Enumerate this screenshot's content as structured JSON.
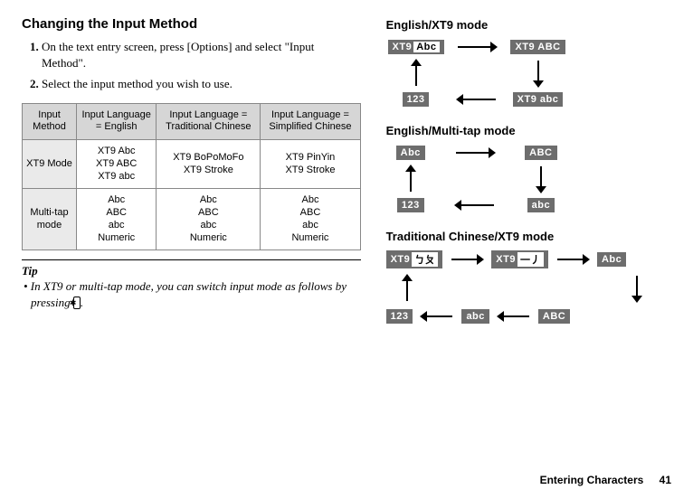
{
  "left": {
    "heading": "Changing the Input Method",
    "steps": [
      "On the text entry screen, press [Options] and select \"Input Method\".",
      "Select the input method you wish to use."
    ],
    "table": {
      "headers": {
        "c0": "Input Method",
        "c1": "Input Language = English",
        "c2": "Input Language = Traditional Chinese",
        "c3": "Input Language = Simplified Chinese"
      },
      "rows": [
        {
          "label": "XT9 Mode",
          "c1": "XT9 Abc\nXT9 ABC\nXT9 abc",
          "c2": "XT9 BoPoMoFo\nXT9 Stroke",
          "c3": "XT9 PinYin\nXT9 Stroke"
        },
        {
          "label": "Multi-tap mode",
          "c1": "Abc\nABC\nabc\nNumeric",
          "c2": "Abc\nABC\nabc\nNumeric",
          "c3": "Abc\nABC\nabc\nNumeric"
        }
      ]
    },
    "tip_heading": "Tip",
    "tip_body_before": "•  In XT9 or multi-tap mode, you can switch input mode as follows by pressing ",
    "tip_key": "✱",
    "tip_body_after": "."
  },
  "right": {
    "h1": "English/XT9 mode",
    "h2": "English/Multi-tap mode",
    "h3": "Traditional Chinese/XT9 mode",
    "badges": {
      "xt9_abc_mixed": "XT9",
      "xt9_abc_mixed_txt": "Abc",
      "xt9_abc_upper": "XT9 ABC",
      "xt9_abc_lower": "XT9 abc",
      "num123": "123",
      "abc_mixed": "Abc",
      "abc_upper": "ABC",
      "abc_lower": "abc",
      "xt9_bopo": "XT9",
      "xt9_bopo_txt": "ㄅㄆ",
      "xt9_stroke": "XT9",
      "xt9_stroke_txt": "一丿"
    }
  },
  "footer": {
    "section": "Entering Characters",
    "page": "41"
  }
}
